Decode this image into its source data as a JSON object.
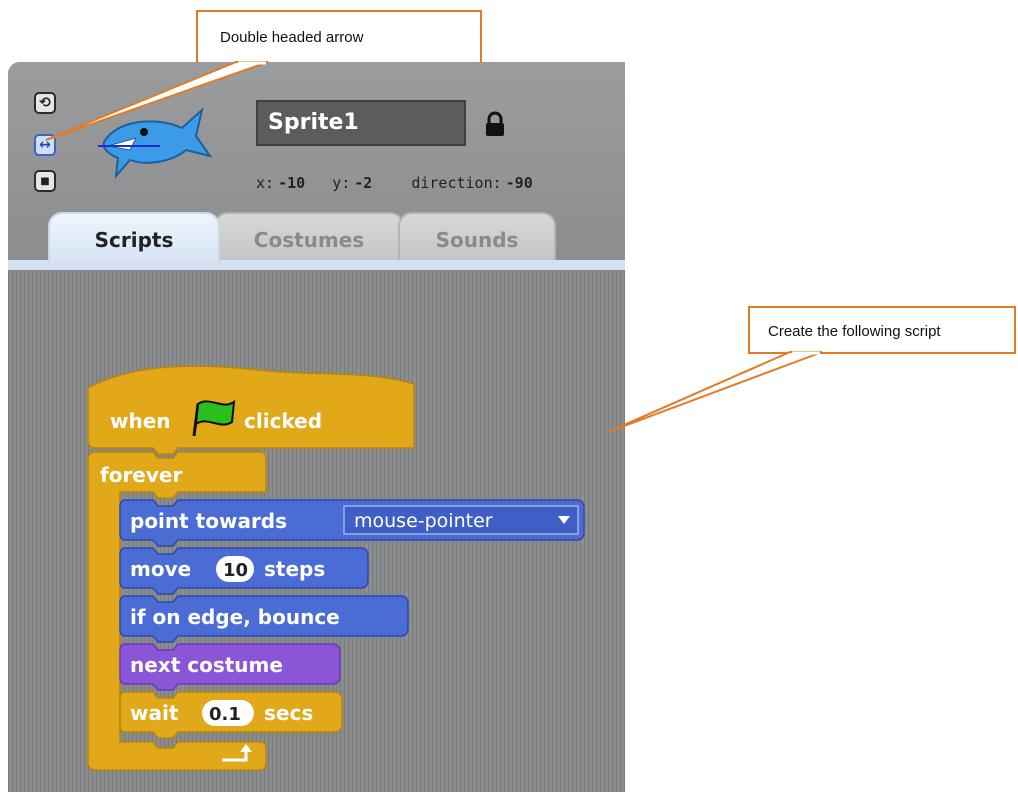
{
  "sprite": {
    "name": "Sprite1",
    "x_label": "x:",
    "x_value": "-10",
    "y_label": "y:",
    "y_value": "-2",
    "direction_label": "direction:",
    "direction_value": "-90"
  },
  "rotation_buttons": [
    {
      "icon": "rotate-icon",
      "glyph": "⟲"
    },
    {
      "icon": "left-right-arrow-icon",
      "glyph": "↔"
    },
    {
      "icon": "no-rotate-icon",
      "glyph": "■"
    }
  ],
  "tabs": [
    {
      "label": "Scripts",
      "selected": true
    },
    {
      "label": "Costumes",
      "selected": false
    },
    {
      "label": "Sounds",
      "selected": false
    }
  ],
  "script": {
    "hat": {
      "prefix": "when",
      "suffix": "clicked",
      "icon": "green-flag-icon"
    },
    "loop": "forever",
    "blocks": {
      "point": {
        "label": "point towards",
        "dropdown": "mouse-pointer"
      },
      "move": {
        "prefix": "move",
        "value": "10",
        "suffix": "steps"
      },
      "bounce": {
        "label": "if on edge, bounce"
      },
      "costume": {
        "label": "next costume"
      },
      "wait": {
        "prefix": "wait",
        "value": "0.1",
        "suffix": "secs"
      }
    }
  },
  "callouts": {
    "arrow_note": "Double headed arrow",
    "script_note": "Create the following script"
  },
  "colors": {
    "motion": "#4a6cd4",
    "control": "#e1a91a",
    "looks": "#8a55d7",
    "callout_border": "#e07b26"
  }
}
